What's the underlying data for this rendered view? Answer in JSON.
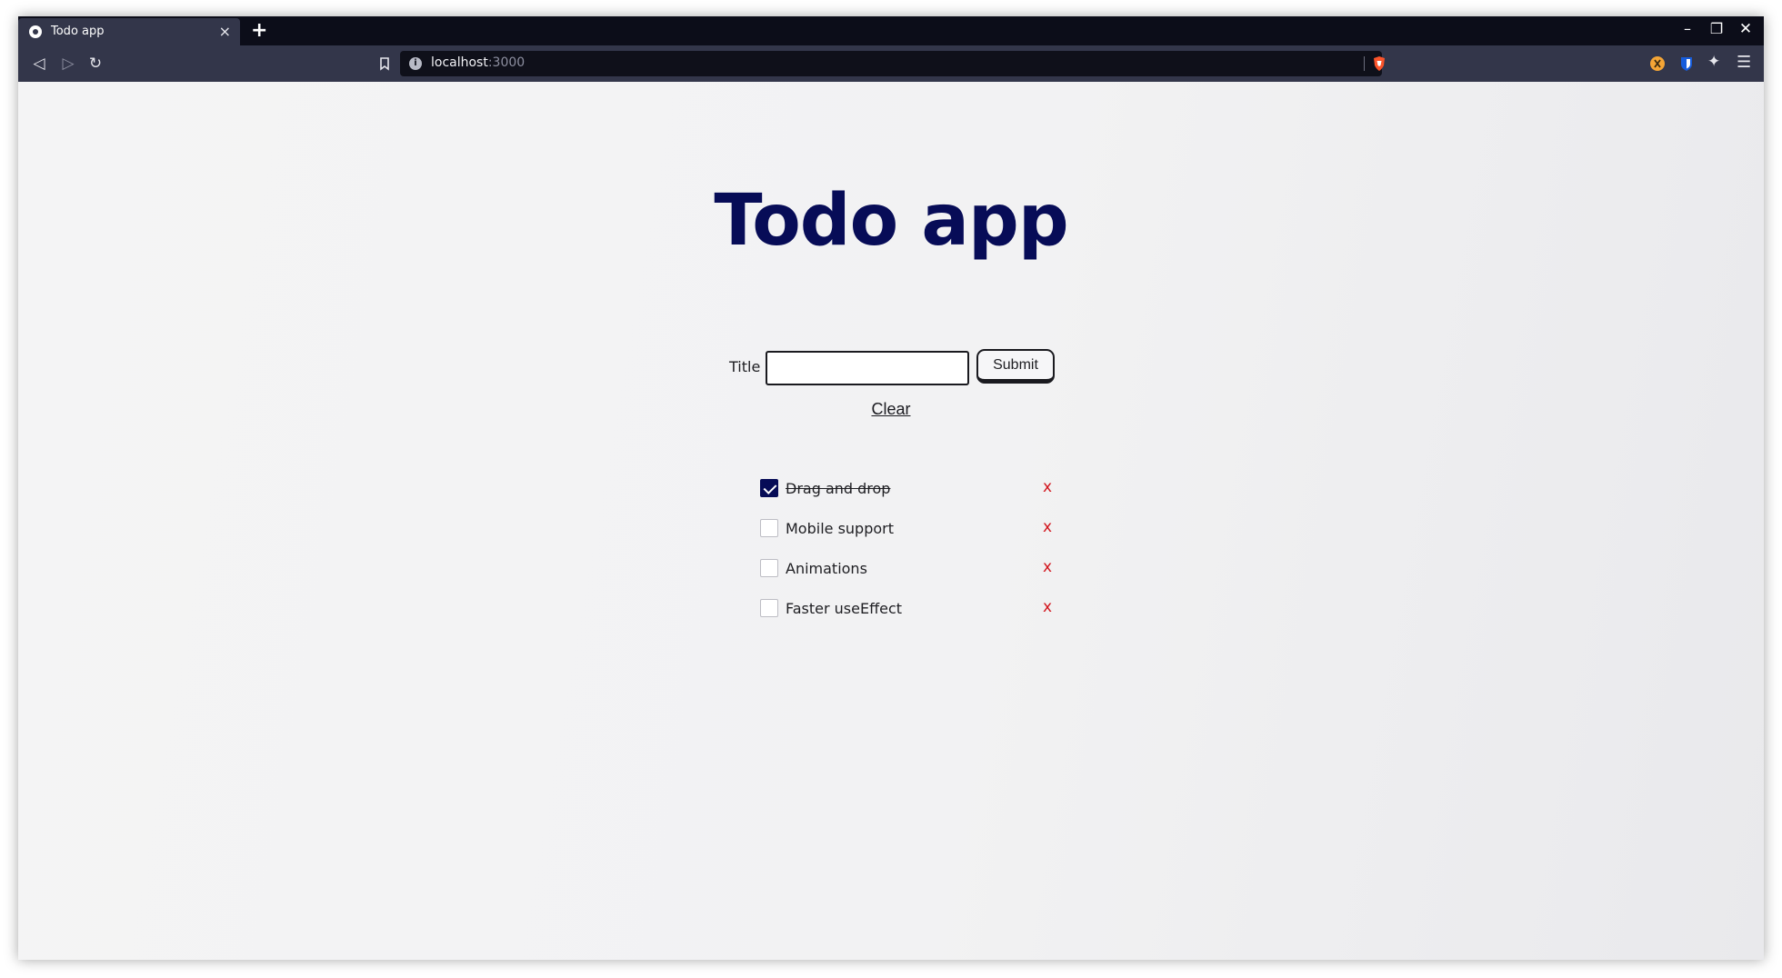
{
  "browser": {
    "tab_title": "Todo app",
    "tab_close": "×",
    "new_tab": "+",
    "url_host": "localhost",
    "url_port": ":3000",
    "window_controls": {
      "minimize": "–",
      "maximize": "❐",
      "close": "✕"
    },
    "nav": {
      "back": "◁",
      "forward": "▷",
      "reload": "↻"
    }
  },
  "app": {
    "heading": "Todo app",
    "form": {
      "title_label": "Title",
      "title_value": "",
      "submit_label": "Submit"
    },
    "clear_label": "Clear",
    "todos": [
      {
        "title": "Drag and drop",
        "done": true,
        "delete_label": "x"
      },
      {
        "title": "Mobile support",
        "done": false,
        "delete_label": "x"
      },
      {
        "title": "Animations",
        "done": false,
        "delete_label": "x"
      },
      {
        "title": "Faster useEffect",
        "done": false,
        "delete_label": "x"
      }
    ]
  },
  "colors": {
    "heading": "#070c57",
    "delete": "#d2151d",
    "checked": "#070c57"
  }
}
